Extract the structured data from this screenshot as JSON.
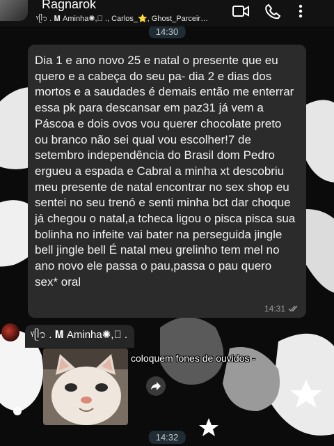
{
  "header": {
    "title": "Ragnarok",
    "subtitle": "ᵞᥫ᭡ . 𝐌 Aminha✺,⃝ ., Carlos_⭐, Ghost_Parceir…",
    "icons": [
      "video-call-icon",
      "voice-call-icon",
      "more-options-icon"
    ]
  },
  "chips": {
    "top_time": "14:30",
    "bottom_time": "14:32"
  },
  "message1": {
    "text": "Dia 1 e ano novo 25 e natal o presente que eu quero e a cabeça do seu pa- dia 2 e dias dos mortos e a saudades é demais então me enterrar essa pk para descansar em paz31 já vem a Páscoa e dois ovos vou querer chocolate preto ou branco não sei qual vou escolher!7 de setembro independência do Brasil dom Pedro ergueu a espada e Cabral a minha xt descobriu meu presente de natal encontrar no sex shop eu sentei no seu trenó e senti minha bct dar choque já chegou o natal,a tcheca ligou o pisca pisca sua bolinha no infeite vai bater na perseguida jingle bell jingle bell É natal meu grelinho tem mel no ano novo ele passa o pau,passa o pau quero sex* oral",
    "time": "14:31",
    "status_icon": "double-check-icon"
  },
  "message2": {
    "sender": "ᵞᥫ᭡ . 𝐌 Aminha✺,⃝ .",
    "caption": "coloquem fones de ouvidos -",
    "forward_icon": "forward-icon"
  },
  "colors": {
    "header_bg": "#121212",
    "bubble_bg": "#2b2b2b",
    "chip_bg": "#1f2c34"
  }
}
